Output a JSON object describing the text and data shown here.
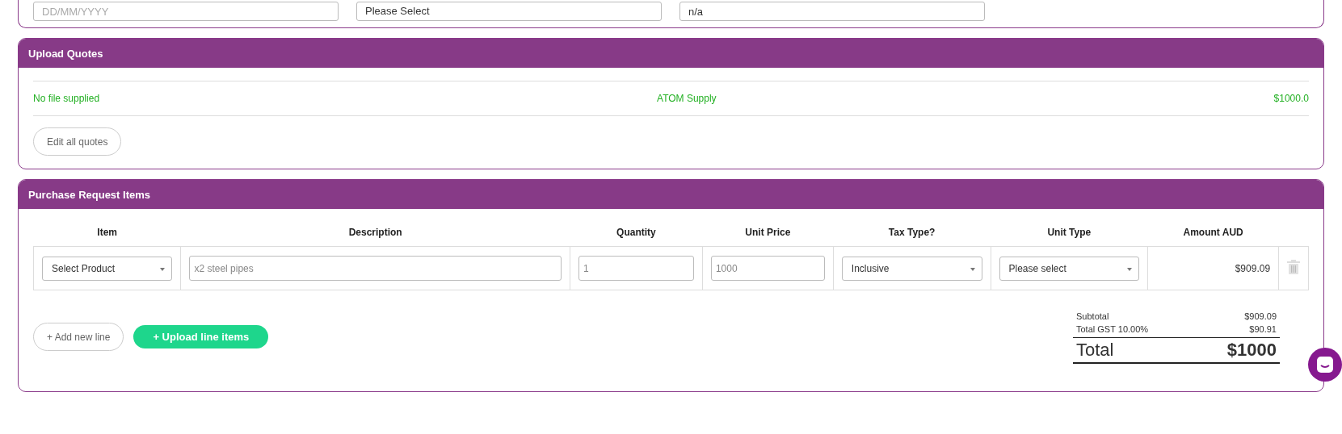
{
  "top_fields": [
    {
      "kind": "date",
      "placeholder": "DD/MM/YYYY"
    },
    {
      "kind": "select",
      "value": "Please Select"
    },
    {
      "kind": "text",
      "value": "n/a"
    }
  ],
  "upload_quotes": {
    "title": "Upload Quotes",
    "quotes": [
      {
        "file": "No file supplied",
        "supplier": "ATOM Supply",
        "amount": "$1000.0"
      }
    ],
    "edit_button": "Edit all quotes"
  },
  "purchase_items": {
    "title": "Purchase Request Items",
    "columns": [
      "Item",
      "Description",
      "Quantity",
      "Unit Price",
      "Tax Type?",
      "Unit Type",
      "Amount AUD"
    ],
    "rows": [
      {
        "item": "Select Product",
        "description": "x2 steel pipes",
        "quantity": "1",
        "unit_price": "1000",
        "tax_type": "Inclusive",
        "unit_type": "Please select",
        "amount": "$909.09"
      }
    ],
    "add_button": "+ Add new line",
    "upload_button": "+ Upload line items",
    "totals": [
      {
        "label": "Subtotal",
        "value": "$909.09"
      },
      {
        "label": "Total GST 10.00%",
        "value": "$90.91"
      }
    ],
    "total": {
      "label": "Total",
      "value": "$1000"
    }
  }
}
